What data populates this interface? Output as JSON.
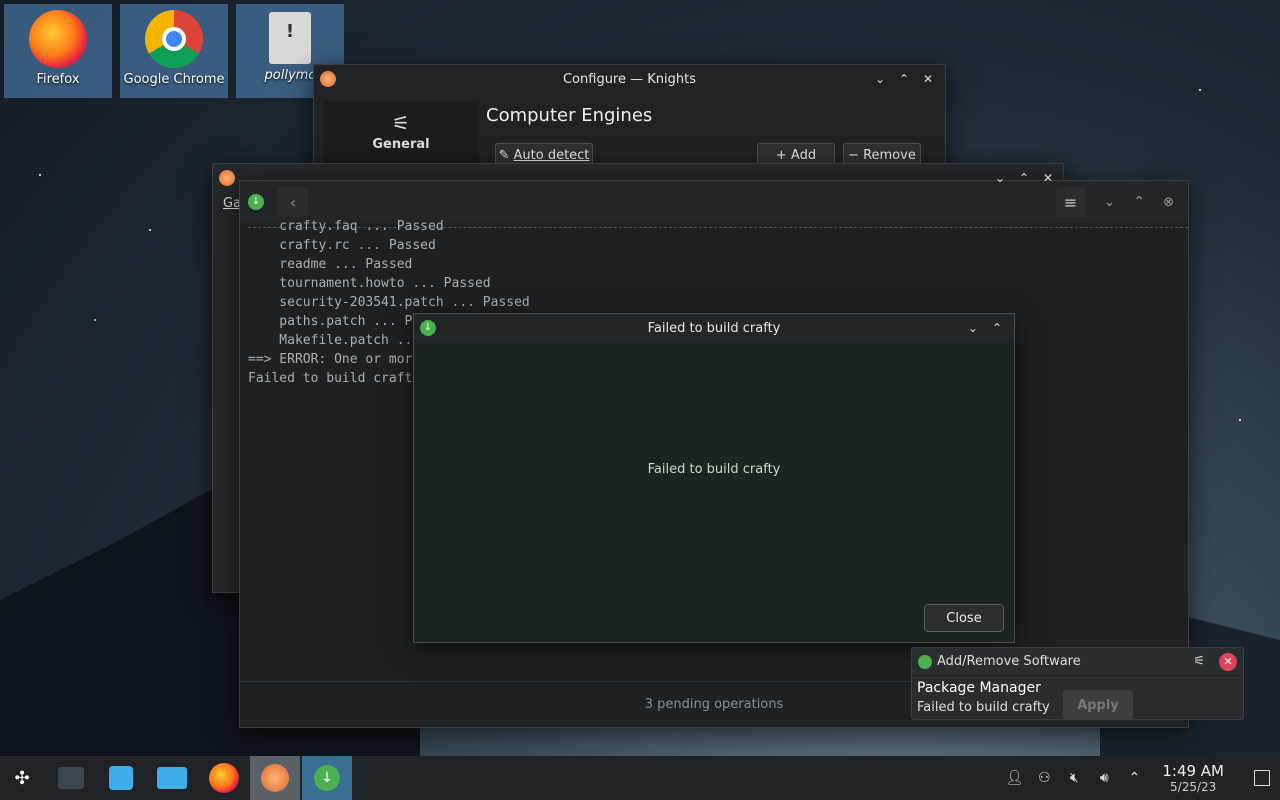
{
  "desktop": {
    "icons": [
      {
        "label": "Firefox"
      },
      {
        "label": "Google Chrome"
      },
      {
        "label": "pollymc"
      }
    ]
  },
  "knights_window": {
    "title": "Configure — Knights",
    "sidebar_item": "General",
    "section_title": "Computer Engines",
    "auto_detect": "Auto detect",
    "add": "+ Add",
    "remove": "Remove"
  },
  "knights_main": {
    "menu_label": "Ga"
  },
  "pamac_window": {
    "terminal_lines": [
      "    crafty.faq ... Passed",
      "    crafty.rc ... Passed",
      "    readme ... Passed",
      "    tournament.howto ... Passed",
      "    security-203541.patch ... Passed",
      "    paths.patch ... P",
      "    Makefile.patch ...",
      "==> ERROR: One or mor",
      "Failed to build craft"
    ],
    "status": "3 pending operations"
  },
  "dialog": {
    "title": "Failed to build crafty",
    "message": "Failed to build crafty",
    "close": "Close"
  },
  "notification": {
    "app": "Add/Remove Software",
    "title": "Package Manager",
    "body": "Failed to build crafty",
    "action": "Apply"
  },
  "taskbar": {
    "time": "1:49 AM",
    "date": "5/25/23"
  },
  "colors": {
    "accent": "#3daee9",
    "pamac_green": "#4caf50",
    "dialog_bg": "#1c2420"
  }
}
